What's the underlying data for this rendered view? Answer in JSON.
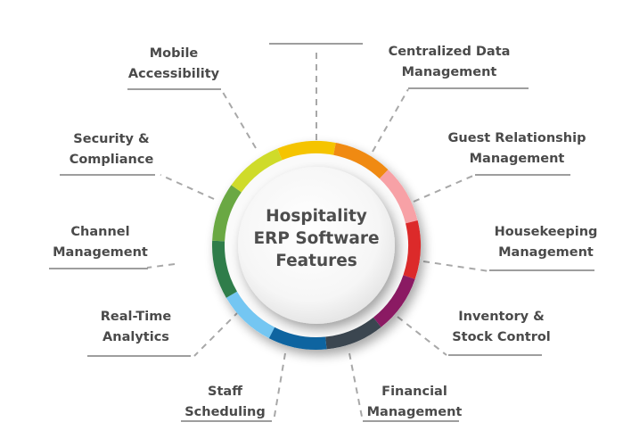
{
  "diagram": {
    "title_lines": [
      "Hospitality",
      "ERP Software",
      "Features"
    ],
    "ring_colors": [
      "#f5c400",
      "#f08a12",
      "#f7a1a6",
      "#dc2a2a",
      "#8b1a63",
      "#3b4650",
      "#0e64a0",
      "#74c6f2",
      "#2f7d4a",
      "#6aa843",
      "#cfdb2a"
    ],
    "features": [
      {
        "id": "top-empty",
        "lines": []
      },
      {
        "id": "centralized-data-management",
        "lines": [
          "Centralized Data",
          "Management"
        ]
      },
      {
        "id": "guest-relationship-management",
        "lines": [
          "Guest Relationship",
          "Management"
        ]
      },
      {
        "id": "housekeeping-management",
        "lines": [
          "Housekeeping",
          "Management"
        ]
      },
      {
        "id": "inventory-stock-control",
        "lines": [
          "Inventory &",
          "Stock Control"
        ]
      },
      {
        "id": "financial-management",
        "lines": [
          "Financial",
          "Management"
        ]
      },
      {
        "id": "staff-scheduling",
        "lines": [
          "Staff",
          "Scheduling"
        ]
      },
      {
        "id": "real-time-analytics",
        "lines": [
          "Real-Time",
          "Analytics"
        ]
      },
      {
        "id": "channel-management",
        "lines": [
          "Channel",
          "Management"
        ]
      },
      {
        "id": "security-compliance",
        "lines": [
          "Security &",
          "Compliance"
        ]
      },
      {
        "id": "mobile-accessibility",
        "lines": [
          "Mobile",
          "Accessibility"
        ]
      }
    ]
  }
}
